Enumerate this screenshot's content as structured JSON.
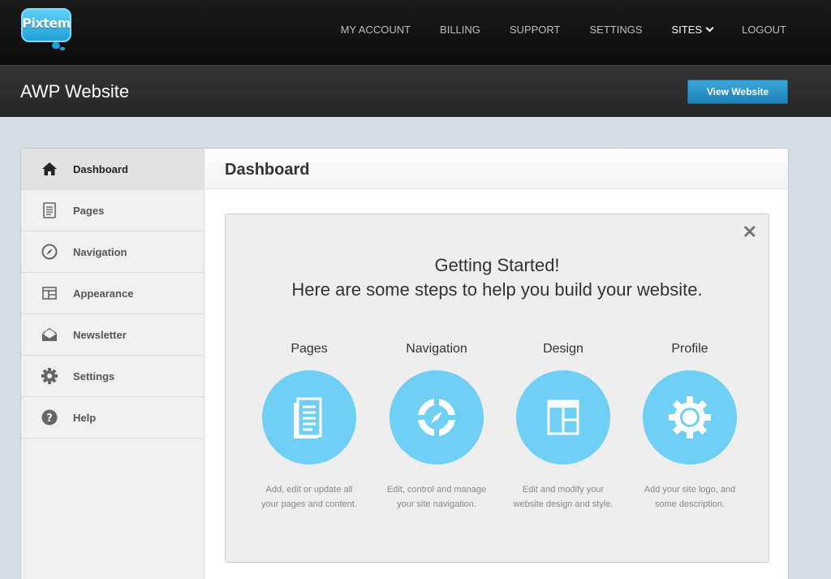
{
  "brand": {
    "logo_text": "Pixtem"
  },
  "nav": {
    "items": [
      "MY ACCOUNT",
      "BILLING",
      "SUPPORT",
      "SETTINGS",
      "SITES",
      "LOGOUT"
    ]
  },
  "header": {
    "site_title": "AWP Website",
    "view_button": "View Website"
  },
  "sidebar": {
    "items": [
      {
        "label": "Dashboard",
        "icon": "home-icon"
      },
      {
        "label": "Pages",
        "icon": "page-icon"
      },
      {
        "label": "Navigation",
        "icon": "compass-icon"
      },
      {
        "label": "Appearance",
        "icon": "layout-icon"
      },
      {
        "label": "Newsletter",
        "icon": "envelope-icon"
      },
      {
        "label": "Settings",
        "icon": "gear-icon"
      },
      {
        "label": "Help",
        "icon": "help-icon"
      }
    ]
  },
  "main": {
    "title": "Dashboard",
    "getting_started": {
      "line1": "Getting Started!",
      "line2": "Here are some steps to help you build your website.",
      "close": "✕",
      "steps": [
        {
          "title": "Pages",
          "desc1": "Add, edit or update all",
          "desc2": "your pages and content."
        },
        {
          "title": "Navigation",
          "desc1": "Edit, control and manage",
          "desc2": "your site navigation."
        },
        {
          "title": "Design",
          "desc1": "Edit and modify your",
          "desc2": "website design and style."
        },
        {
          "title": "Profile",
          "desc1": "Add your site logo, and",
          "desc2": "some description."
        }
      ]
    }
  },
  "colors": {
    "accent": "#6fcff4",
    "button": "#2a95cc",
    "topbar": "#111111"
  }
}
